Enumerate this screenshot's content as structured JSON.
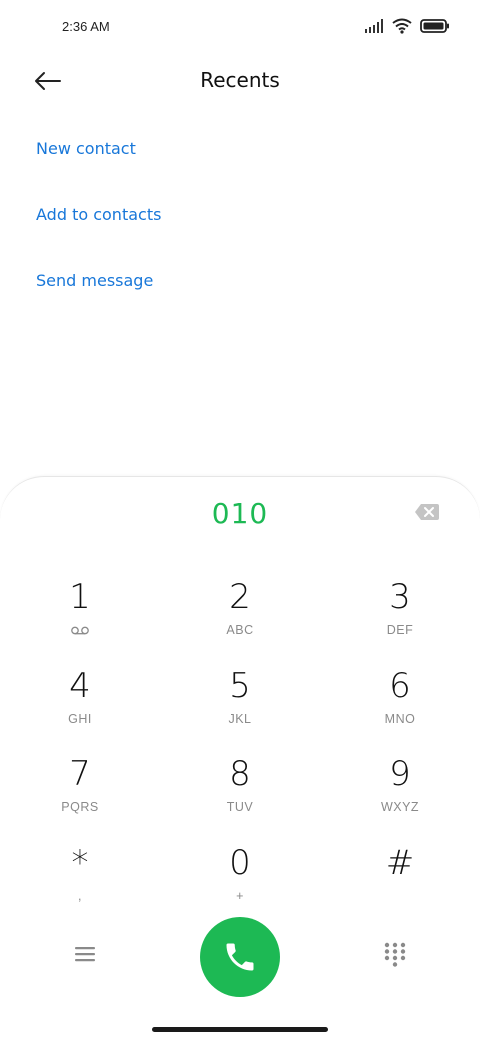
{
  "status_bar": {
    "time": "2:36 AM"
  },
  "header": {
    "title": "Recents"
  },
  "actions": [
    {
      "label": "New contact"
    },
    {
      "label": "Add to contacts"
    },
    {
      "label": "Send message"
    }
  ],
  "dialer": {
    "number": "010",
    "keys": [
      {
        "digit": "1",
        "letters": ""
      },
      {
        "digit": "2",
        "letters": "ABC"
      },
      {
        "digit": "3",
        "letters": "DEF"
      },
      {
        "digit": "4",
        "letters": "GHI"
      },
      {
        "digit": "5",
        "letters": "JKL"
      },
      {
        "digit": "6",
        "letters": "MNO"
      },
      {
        "digit": "7",
        "letters": "PQRS"
      },
      {
        "digit": "8",
        "letters": "TUV"
      },
      {
        "digit": "9",
        "letters": "WXYZ"
      },
      {
        "digit": "*",
        "letters": ","
      },
      {
        "digit": "0",
        "letters": "+"
      },
      {
        "digit": "#",
        "letters": ""
      }
    ]
  },
  "colors": {
    "accent_link": "#1877d9",
    "call_green": "#1db954",
    "number_green": "#1db954"
  },
  "icons": [
    "signal-icon",
    "wifi-icon",
    "battery-icon",
    "back-arrow-icon",
    "backspace-icon",
    "voicemail-icon",
    "menu-icon",
    "phone-icon",
    "keypad-icon"
  ]
}
